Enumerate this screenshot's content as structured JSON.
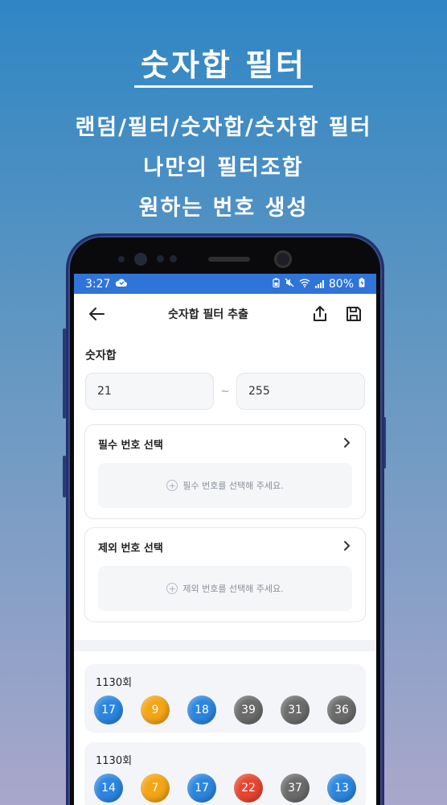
{
  "promo": {
    "title": "숫자합 필터",
    "lines": [
      "랜덤/필터/숫자합/숫자합 필터",
      "나만의 필터조합",
      "원하는 번호 생성"
    ]
  },
  "status": {
    "time": "3:27",
    "battery": "80%"
  },
  "appbar": {
    "title": "숫자합 필터 추출"
  },
  "sum": {
    "label": "숫자합",
    "min": "21",
    "max": "255",
    "separator": "~"
  },
  "required": {
    "title": "필수 번호 선택",
    "placeholder": "필수 번호를 선택해 주세요."
  },
  "excluded": {
    "title": "제외 번호 선택",
    "placeholder": "제외 번호를 선택해 주세요."
  },
  "draws": [
    {
      "round": "1130회",
      "numbers": [
        "17",
        "9",
        "18",
        "39",
        "31",
        "36"
      ]
    },
    {
      "round": "1130회",
      "numbers": [
        "14",
        "7",
        "17",
        "22",
        "37",
        "13"
      ]
    }
  ],
  "colors": {
    "status_bar": "#2f74d9",
    "ball_yellow": "#f4a516",
    "ball_blue": "#2b86e0",
    "ball_red": "#e8452f",
    "ball_gray": "#6b6b6b"
  }
}
